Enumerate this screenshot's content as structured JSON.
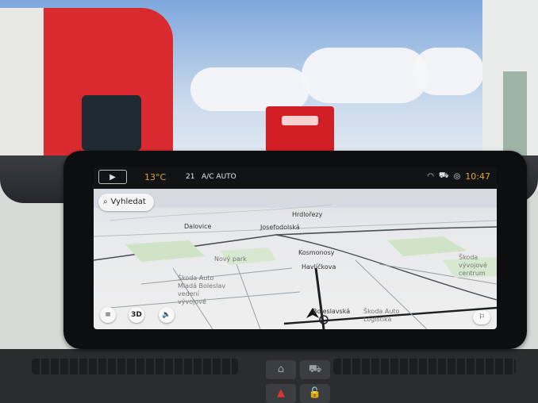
{
  "status_bar": {
    "media_icon": "play-icon",
    "outside_temp": "13°C",
    "ac_temp": "21",
    "ac_label": "A/C",
    "ac_mode": "AUTO",
    "icons": [
      "wifi-icon",
      "car-icon",
      "location-icon"
    ],
    "time": "10:47"
  },
  "map": {
    "search_label": "Vyhledat",
    "labels": {
      "hrdlorezy": "Hrdlořezy",
      "dalovice": "Dalovice",
      "josefodolska": "Josefodolská",
      "kosmonosy": "Kosmonosy",
      "havlickova": "Havlíčkova",
      "novy_park": "Nový park",
      "skoda": "Škoda Auto\nMladá Boleslav\nvedení\nvývojové",
      "boleslavska": "Boleslavská",
      "right_poi": "Škoda Auto\nLogistika",
      "far_right": "Škoda\nvývojové\ncentrum"
    },
    "controls": {
      "menu_icon": "menu-icon",
      "view_mode": "3D",
      "volume_icon": "volume-icon",
      "report_icon": "report-pin-icon"
    }
  },
  "dashboard": {
    "buttons": [
      "home-icon",
      "car-icon",
      "hazard-icon",
      "lock-icon"
    ]
  }
}
